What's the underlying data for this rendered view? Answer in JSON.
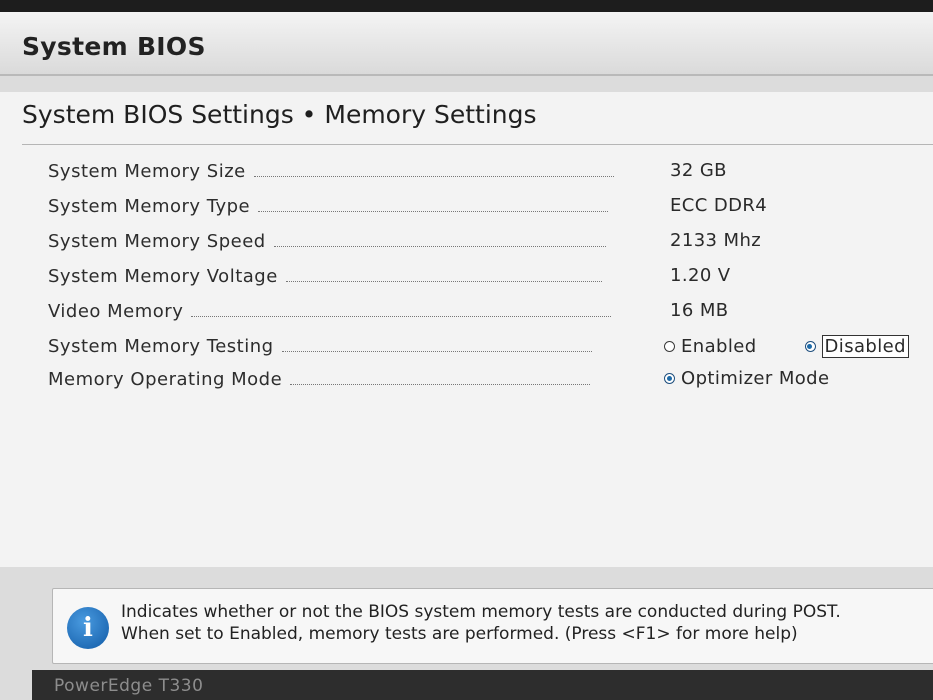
{
  "app": {
    "title": "System BIOS"
  },
  "page": {
    "title": "System BIOS Settings • Memory Settings"
  },
  "settings": [
    {
      "label": "System Memory Size",
      "value": "32 GB"
    },
    {
      "label": "System Memory Type",
      "value": "ECC DDR4"
    },
    {
      "label": "System Memory Speed",
      "value": "2133 Mhz"
    },
    {
      "label": "System Memory Voltage",
      "value": "1.20 V"
    },
    {
      "label": "Video Memory",
      "value": "16 MB"
    },
    {
      "label": "System Memory Testing",
      "options": [
        {
          "label": "Enabled",
          "selected": false
        },
        {
          "label": "Disabled",
          "selected": true
        }
      ]
    },
    {
      "label": "Memory Operating Mode",
      "options": [
        {
          "label": "Optimizer Mode",
          "selected": true
        }
      ]
    }
  ],
  "help": {
    "text": "Indicates whether or not the BIOS system memory tests are conducted during POST.\nWhen set to Enabled, memory tests are performed. (Press <F1> for more help)"
  },
  "footer": {
    "model": "PowerEdge T330"
  },
  "colors": {
    "accent": "#1d6aa8",
    "background": "#f3f3f3",
    "footer": "#2d2d2d"
  }
}
